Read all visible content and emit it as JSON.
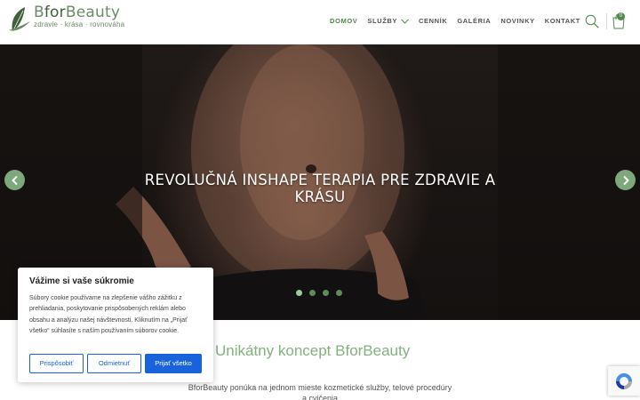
{
  "brand": {
    "name_light": "B",
    "name_dark": "for",
    "name_rest": "Beauty",
    "tagline": "zdravie · krása · rovnováha"
  },
  "nav": {
    "items": [
      {
        "label": "DOMOV",
        "active": true
      },
      {
        "label": "SLUŽBY",
        "has_dropdown": true
      },
      {
        "label": "CENNÍK"
      },
      {
        "label": "GALÉRIA"
      },
      {
        "label": "NOVINKY"
      },
      {
        "label": "KONTAKT"
      }
    ],
    "cart_count": "0"
  },
  "hero": {
    "title": "REVOLUČNÁ INSHAPE TERAPIA PRE ZDRAVIE A KRÁSU",
    "slide_count": 4,
    "active_slide": 1
  },
  "section": {
    "title": "Unikátny koncept BforBeauty",
    "text": "BforBeauty ponúka na jednom mieste kozmetické služby, telové procedúry a cvičenia"
  },
  "cookie": {
    "title": "Vážime si vaše súkromie",
    "text": "Súbory cookie používame na zlepšenie vášho zážitku z prehliadania, poskytovanie prispôsobených reklám alebo obsahu a analýzu našej návštevnosti. Kliknutím na „Prijať všetko“ súhlasíte s naším používaním súborov cookie.",
    "customize_label": "Prispôsobiť",
    "reject_label": "Odmietnuť",
    "accept_label": "Prijať všetko"
  },
  "colors": {
    "brand_green": "#4e8a4b",
    "accent_light_green": "#84b080",
    "cookie_blue": "#1863dc"
  },
  "icons": [
    "leaf-logo-icon",
    "chevron-down-icon",
    "search-icon",
    "cart-icon",
    "arrow-left-icon",
    "arrow-right-icon",
    "recaptcha-icon"
  ]
}
